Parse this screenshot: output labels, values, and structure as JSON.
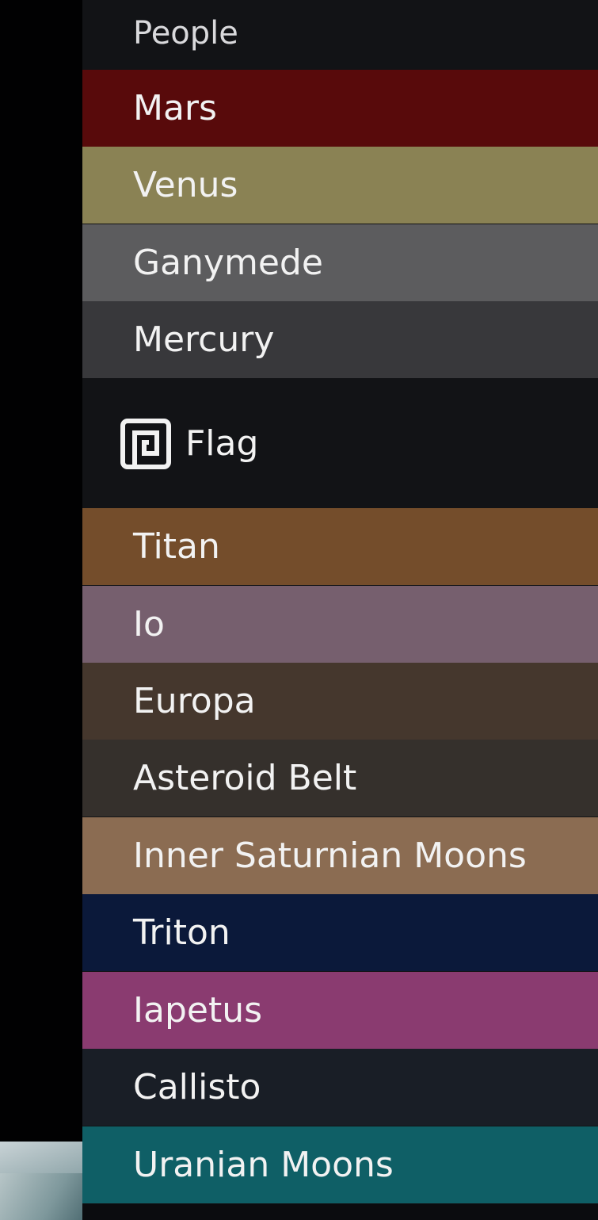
{
  "header": {
    "label": "People"
  },
  "people": [
    {
      "label": "Mars",
      "color": "#580a0b"
    },
    {
      "label": "Venus",
      "color": "#8a8254"
    },
    {
      "label": "Ganymede",
      "color": "#5c5c5e"
    },
    {
      "label": "Mercury",
      "color": "#38383b"
    }
  ],
  "flag_section": {
    "label": "Flag",
    "icon": "flag-icon"
  },
  "flags": [
    {
      "label": "Titan",
      "color": "#744d2b"
    },
    {
      "label": "Io",
      "color": "#765f6e"
    },
    {
      "label": "Europa",
      "color": "#45372d"
    },
    {
      "label": "Asteroid Belt",
      "color": "#35302c"
    },
    {
      "label": "Inner Saturnian Moons",
      "color": "#8b6c52"
    },
    {
      "label": "Triton",
      "color": "#0b193a"
    },
    {
      "label": "Iapetus",
      "color": "#8a3b70"
    },
    {
      "label": "Callisto",
      "color": "#191e26"
    },
    {
      "label": "Uranian Moons",
      "color": "#0f5f66"
    }
  ]
}
